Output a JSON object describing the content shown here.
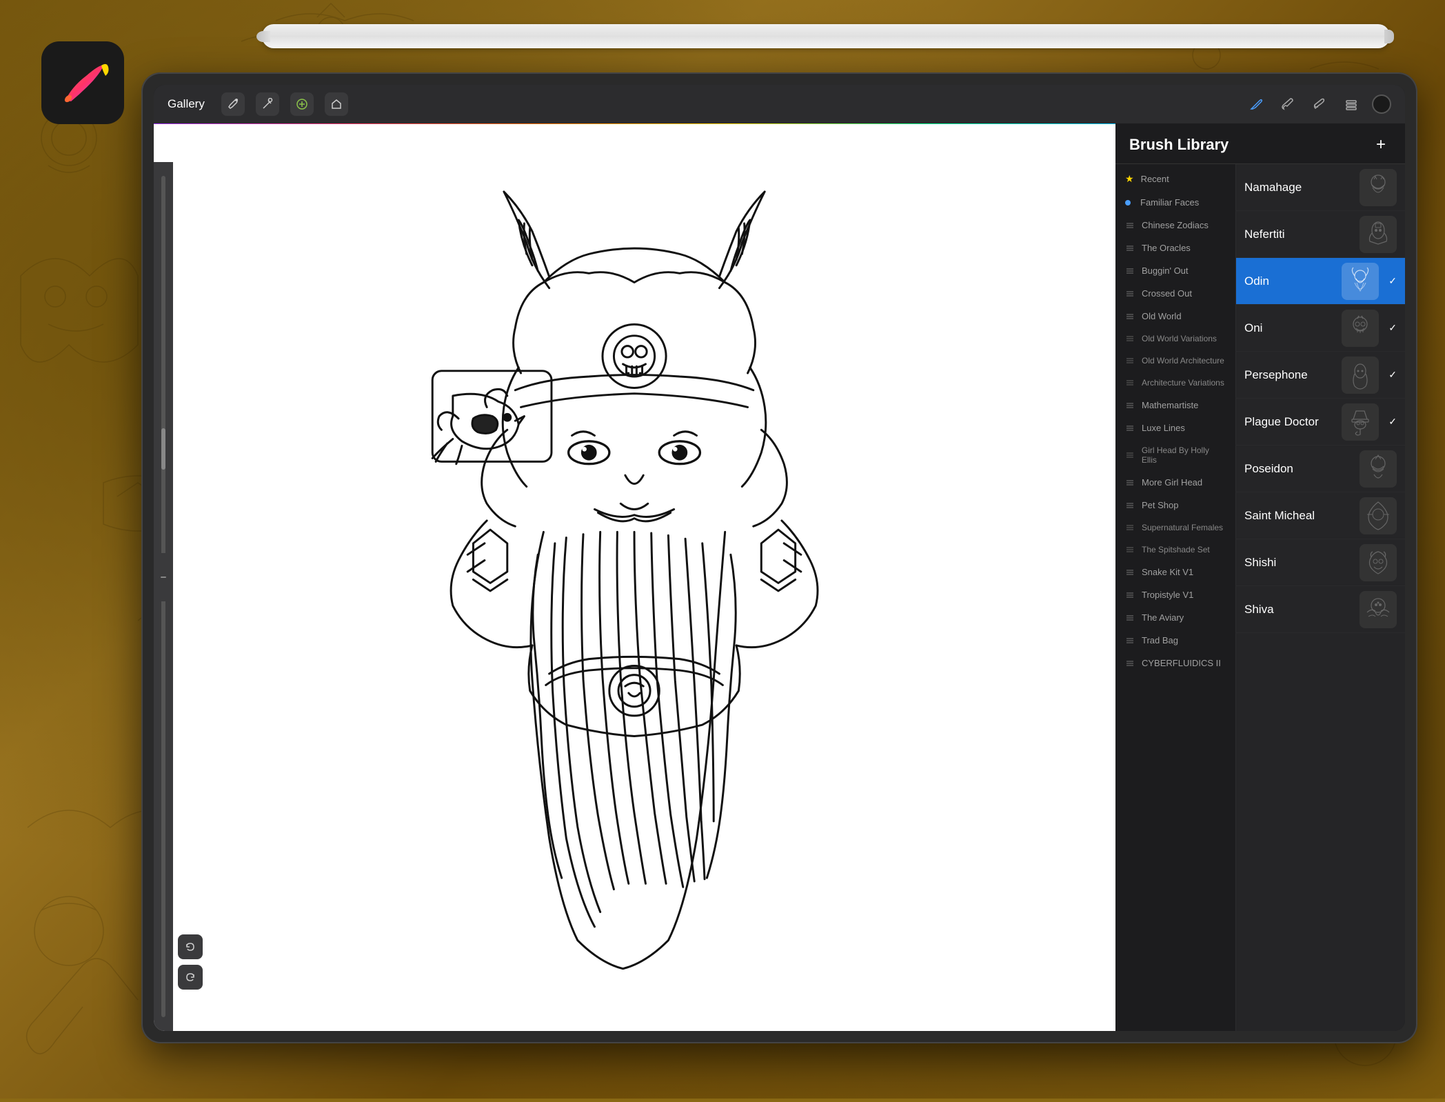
{
  "app": {
    "title": "Procreate"
  },
  "stylus": {
    "visible": true
  },
  "toolbar": {
    "gallery_label": "Gallery",
    "tools": [
      "wrench",
      "magic",
      "history",
      "flag"
    ],
    "right_tools": [
      "pen-active",
      "brush",
      "pencil",
      "layers"
    ],
    "color": "#1a1a1a"
  },
  "brush_library": {
    "title": "Brush Library",
    "add_label": "+",
    "categories": [
      {
        "id": "recent",
        "label": "Recent",
        "icon": "star",
        "type": "star"
      },
      {
        "id": "familiar-faces",
        "label": "Familiar Faces",
        "icon": "brush",
        "active_dot": true
      },
      {
        "id": "chinese-zodiacs",
        "label": "Chinese Zodiacs",
        "icon": "brush"
      },
      {
        "id": "the-oracles",
        "label": "The Oracles",
        "icon": "brush"
      },
      {
        "id": "buggin-out",
        "label": "Buggin' Out",
        "icon": "brush"
      },
      {
        "id": "crossed-out",
        "label": "Crossed Out",
        "icon": "brush"
      },
      {
        "id": "old-world",
        "label": "Old World",
        "icon": "brush"
      },
      {
        "id": "old-world-variations",
        "label": "Old World Variations",
        "icon": "brush",
        "small": true
      },
      {
        "id": "old-world-architecture",
        "label": "Old World Architecture",
        "icon": "brush",
        "small": true
      },
      {
        "id": "architecture-variations",
        "label": "Architecture Variations",
        "icon": "brush",
        "small": true
      },
      {
        "id": "mathemartiste",
        "label": "Mathemartiste",
        "icon": "brush"
      },
      {
        "id": "luxe-lines",
        "label": "Luxe Lines",
        "icon": "brush"
      },
      {
        "id": "girl-head",
        "label": "Girl Head By Holly Ellis",
        "icon": "brush",
        "small": true
      },
      {
        "id": "more-girl-head",
        "label": "More Girl Head",
        "icon": "brush"
      },
      {
        "id": "pet-shop",
        "label": "Pet Shop",
        "icon": "brush"
      },
      {
        "id": "supernatural-females",
        "label": "Supernatural Females",
        "icon": "brush",
        "small": true
      },
      {
        "id": "spitshade-set",
        "label": "The Spitshade Set",
        "icon": "brush",
        "small": true
      },
      {
        "id": "snake-kit",
        "label": "Snake Kit V1",
        "icon": "brush"
      },
      {
        "id": "tropistyle",
        "label": "Tropistyle V1",
        "icon": "brush"
      },
      {
        "id": "the-aviary",
        "label": "The Aviary",
        "icon": "brush"
      },
      {
        "id": "trad-bag",
        "label": "Trad Bag",
        "icon": "brush"
      },
      {
        "id": "cyberfluidics",
        "label": "CYBERFLUIDICS II",
        "icon": "brush"
      }
    ],
    "brushes": [
      {
        "id": "namahage",
        "name": "Namahage",
        "subtitle": "",
        "selected": false,
        "has_check": false
      },
      {
        "id": "nefertiti",
        "name": "Nefertiti",
        "subtitle": "",
        "selected": false,
        "has_check": false
      },
      {
        "id": "odin",
        "name": "Odin",
        "subtitle": "",
        "selected": true,
        "has_check": true
      },
      {
        "id": "oni",
        "name": "Oni",
        "subtitle": "",
        "selected": false,
        "has_check": true
      },
      {
        "id": "persephone",
        "name": "Persephone",
        "subtitle": "",
        "selected": false,
        "has_check": true
      },
      {
        "id": "plague-doctor",
        "name": "Plague Doctor",
        "subtitle": "",
        "selected": false,
        "has_check": true
      },
      {
        "id": "poseidon",
        "name": "Poseidon",
        "subtitle": "",
        "selected": false,
        "has_check": false
      },
      {
        "id": "saint-micheal",
        "name": "Saint Micheal",
        "subtitle": "",
        "selected": false,
        "has_check": false
      },
      {
        "id": "shishi",
        "name": "Shishi",
        "subtitle": "",
        "selected": false,
        "has_check": false
      },
      {
        "id": "shiva",
        "name": "Shiva",
        "subtitle": "",
        "selected": false,
        "has_check": false
      }
    ]
  },
  "canvas": {
    "bg": "#ffffff"
  }
}
